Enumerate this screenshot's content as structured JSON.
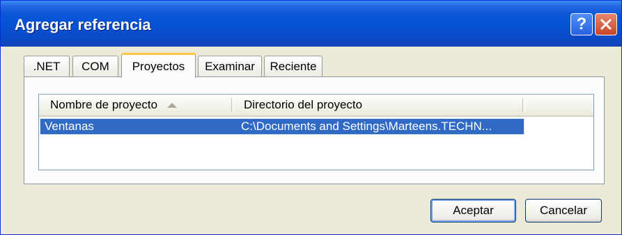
{
  "window": {
    "title": "Agregar referencia"
  },
  "tabs": [
    {
      "label": ".NET"
    },
    {
      "label": "COM"
    },
    {
      "label": "Proyectos",
      "active": true
    },
    {
      "label": "Examinar"
    },
    {
      "label": "Reciente"
    }
  ],
  "list": {
    "columns": [
      {
        "label": "Nombre de proyecto",
        "sorted": "ascending"
      },
      {
        "label": "Directorio del proyecto"
      }
    ],
    "rows": [
      {
        "name": "Ventanas",
        "directory": "C:\\Documents and Settings\\Marteens.TECHN...",
        "selected": true
      }
    ]
  },
  "buttons": {
    "ok_label": "Aceptar",
    "cancel_label": "Cancelar"
  },
  "icons": {
    "help": "help-icon",
    "close": "close-icon",
    "sort": "sort-ascending-icon"
  },
  "colors": {
    "titlebar": "#0a57d8",
    "selection": "#316ac5",
    "active_tab_accent": "#ffc83c",
    "close_button": "#c9452a"
  }
}
